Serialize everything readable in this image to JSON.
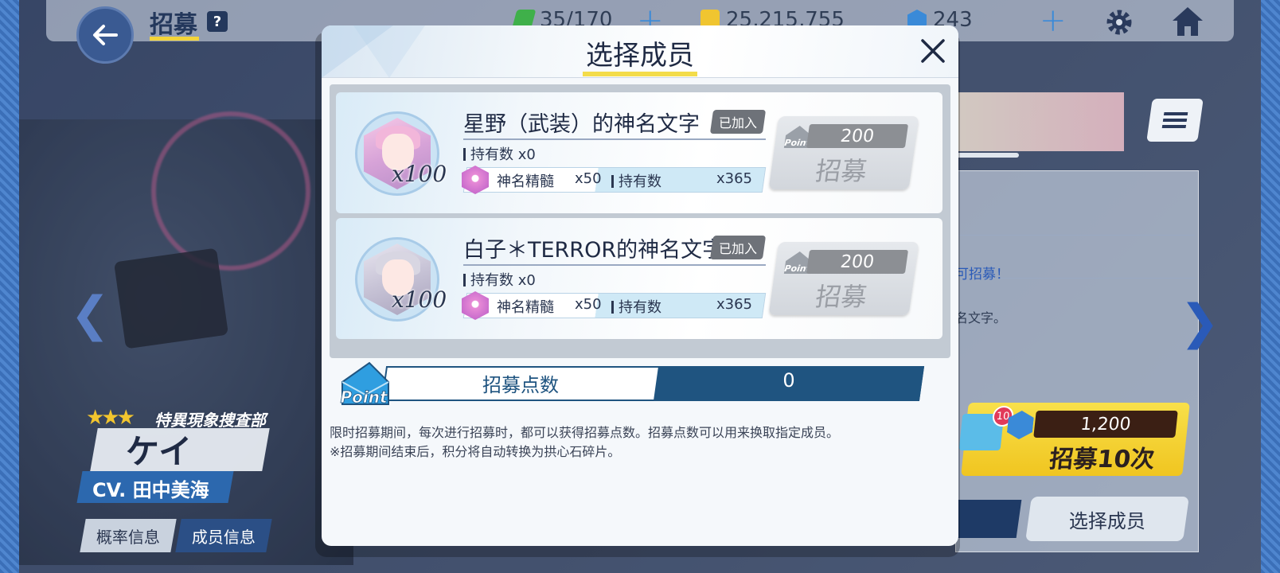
{
  "header": {
    "title": "招募",
    "help": "?",
    "stamina": "35/170",
    "credits": "25,215,755",
    "pyroxene": "243"
  },
  "side_panel": {
    "recruit_hint": "可招募！",
    "recruit_hint2": "名文字。",
    "gacha10": {
      "badge": "10",
      "cost": "1,200",
      "label": "招募10次"
    },
    "select_member": "选择成员"
  },
  "character": {
    "affiliation": "特異現象捜査部",
    "name": "ケイ",
    "cv": "CV. 田中美海",
    "tabs": [
      "概率信息",
      "成员信息"
    ]
  },
  "modal": {
    "title": "选择成员",
    "cards": [
      {
        "name": "星野（武装）的神名文字",
        "joined": "已加入",
        "multiplier": "x100",
        "owned_label": "持有数",
        "owned_value": "x0",
        "essence_name": "神名精髓",
        "essence_qty": "x50",
        "essence_owned_label": "持有数",
        "essence_owned": "x365",
        "cost": "200",
        "recruit": "招募"
      },
      {
        "name": "白子＊TERROR的神名文字",
        "joined": "已加入",
        "multiplier": "x100",
        "owned_label": "持有数",
        "owned_value": "x0",
        "essence_name": "神名精髓",
        "essence_qty": "x50",
        "essence_owned_label": "持有数",
        "essence_owned": "x365",
        "cost": "200",
        "recruit": "招募"
      }
    ],
    "point_icon_text": "Point",
    "points_label": "招募点数",
    "points_value": "0",
    "desc_line1": "限时招募期间，每次进行招募时，都可以获得招募点数。招募点数可以用来换取指定成员。",
    "desc_line2": "※招募期间结束后，积分将自动转换为拱心石碎片。"
  },
  "colors": {
    "accent_yellow": "#f3dc4a",
    "navy": "#1f5480",
    "disabled_gray": "#8c8f94"
  }
}
